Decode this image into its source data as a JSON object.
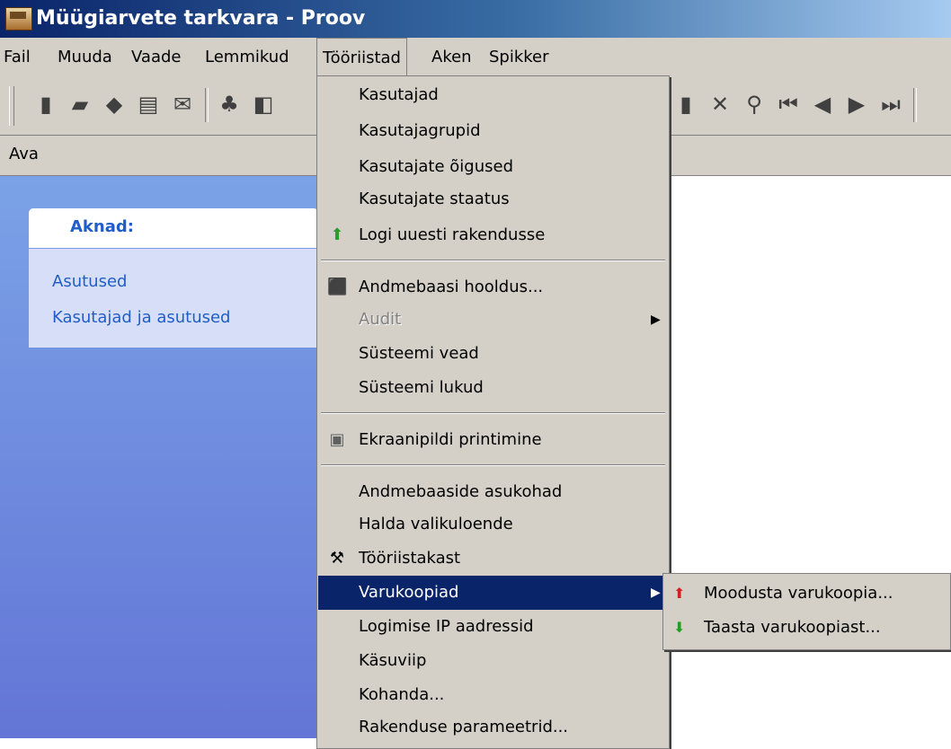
{
  "window": {
    "title": "Müügiarvete tarkvara - Proov",
    "app_icon": "cash-register-icon"
  },
  "menubar": [
    {
      "label": "Fail"
    },
    {
      "label": "Muuda"
    },
    {
      "label": "Vaade"
    },
    {
      "label": "Lemmikud"
    },
    {
      "label": "Tööriistad"
    },
    {
      "label": "Aken"
    },
    {
      "label": "Spikker"
    }
  ],
  "toolbar_left": [
    {
      "icon": "new-document-icon",
      "glyph": "▮"
    },
    {
      "icon": "copy-document-icon",
      "glyph": "▰"
    },
    {
      "icon": "open-document-icon",
      "glyph": "◆"
    },
    {
      "icon": "save-icon",
      "glyph": "▤"
    },
    {
      "icon": "mail-icon",
      "glyph": "✉"
    },
    {
      "icon": "print-icon",
      "glyph": "♣"
    },
    {
      "icon": "print-preview-icon",
      "glyph": "◧"
    }
  ],
  "toolbar_right": [
    {
      "icon": "document-icon",
      "glyph": "▮"
    },
    {
      "icon": "delete-icon",
      "glyph": "✕"
    },
    {
      "icon": "search-icon",
      "glyph": "⚲"
    },
    {
      "icon": "first-record-icon",
      "glyph": "⏮"
    },
    {
      "icon": "previous-record-icon",
      "glyph": "◀"
    },
    {
      "icon": "next-record-icon",
      "glyph": "▶"
    },
    {
      "icon": "last-record-icon",
      "glyph": "⏭"
    }
  ],
  "address": {
    "label": "Ava"
  },
  "task_panel": {
    "title": "Aknad:",
    "links": [
      "Asutused",
      "Kasutajad ja asutused"
    ]
  },
  "dropdown": {
    "items": [
      {
        "label": "Kasutajad"
      },
      {
        "label": "Kasutajagrupid"
      },
      {
        "label": "Kasutajate õigused"
      },
      {
        "label": "Kasutajate staatus"
      },
      {
        "label": "Logi uuesti rakendusse",
        "icon": "green-arrow-icon",
        "glyph": "⬆",
        "color": "#2a9d2a"
      },
      {
        "label": "Andmebaasi hooldus...",
        "icon": "database-wand-icon",
        "glyph": "⬛",
        "color": "#d8b400"
      },
      {
        "label": "Audit",
        "disabled": true,
        "submenu": true
      },
      {
        "label": "Süsteemi vead"
      },
      {
        "label": "Süsteemi lukud"
      },
      {
        "label": "Ekraanipildi printimine",
        "icon": "camera-icon",
        "glyph": "▣",
        "color": "#606060"
      },
      {
        "label": "Andmebaaside asukohad"
      },
      {
        "label": "Halda valikuloende"
      },
      {
        "label": "Tööriistakast",
        "icon": "tools-icon",
        "glyph": "⚒",
        "color": "#000000"
      },
      {
        "label": "Varukoopiad",
        "highlighted": true,
        "submenu": true
      },
      {
        "label": "Logimise IP aadressid"
      },
      {
        "label": "Käsuviip"
      },
      {
        "label": "Kohanda..."
      },
      {
        "label": "Rakenduse parameetrid..."
      }
    ]
  },
  "submenu": {
    "items": [
      {
        "label": "Moodusta varukoopia...",
        "icon": "backup-create-icon",
        "glyph": "⬆",
        "color": "#d02020"
      },
      {
        "label": "Taasta varukoopiast...",
        "icon": "backup-restore-icon",
        "glyph": "⬇",
        "color": "#20a020"
      }
    ]
  },
  "colors": {
    "highlight": "#0a246a",
    "link": "#215dc6",
    "panel_bg": "#d4d0c8"
  }
}
